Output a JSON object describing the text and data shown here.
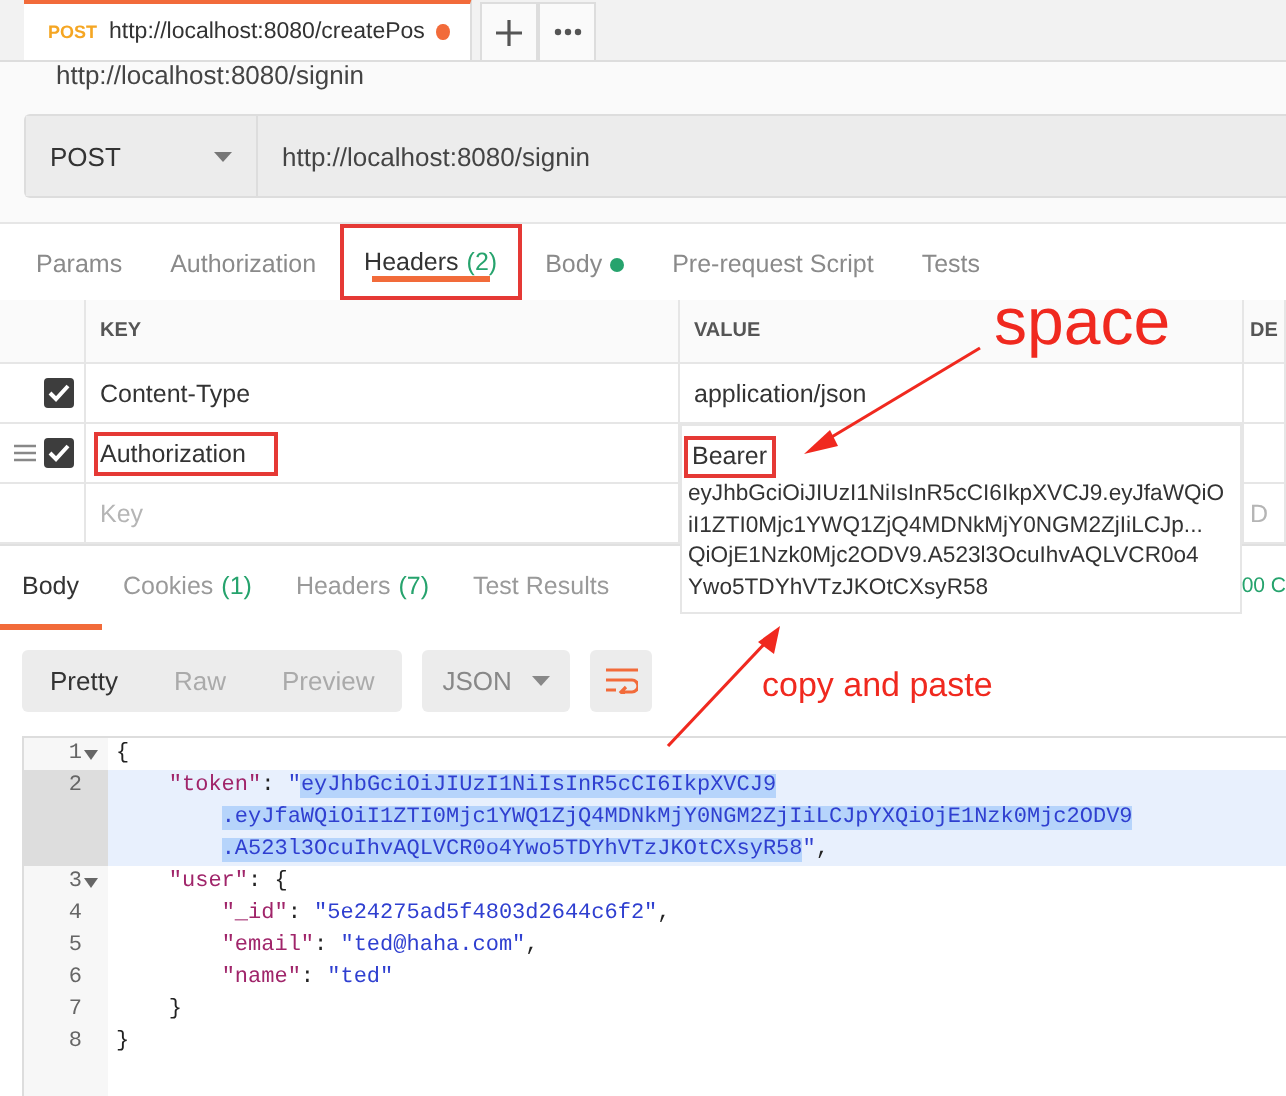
{
  "tabs": [
    {
      "method": "POST",
      "url": "http://localhost:8080/createPos",
      "unsaved": true,
      "selected": true
    }
  ],
  "request_name": "http://localhost:8080/signin",
  "request": {
    "method": "POST",
    "url": "http://localhost:8080/signin"
  },
  "request_tabs": [
    {
      "label": "Params",
      "selected": false,
      "highlighted": false,
      "has_content": false
    },
    {
      "label": "Authorization",
      "selected": false,
      "highlighted": false,
      "has_content": false
    },
    {
      "label": "Headers",
      "count": "(2)",
      "selected": true,
      "highlighted": true,
      "has_content": false
    },
    {
      "label": "Body",
      "selected": false,
      "highlighted": false,
      "has_content": true
    },
    {
      "label": "Pre-request Script",
      "selected": false,
      "highlighted": false,
      "has_content": false
    },
    {
      "label": "Tests",
      "selected": false,
      "highlighted": false,
      "has_content": false
    }
  ],
  "headers": {
    "columns": [
      "KEY",
      "VALUE",
      "DE"
    ],
    "rows": [
      {
        "key": "Content-Type",
        "value": "application/json",
        "checked": true,
        "key_highlighted": false,
        "value_highlighted": false,
        "drag_handle": false,
        "expanded": false
      },
      {
        "key": "Authorization",
        "value": "Bearer",
        "value_continuation": [
          "eyJhbGciOiJIUzI1NiIsInR5cCI6IkpXVCJ9.eyJfaWQiO",
          "iI1ZTI0Mjc1YWQ1ZjQ4MDNkMjY0NGM2ZjIiLCJp...",
          "QiOjE1Nzk0Mjc2ODV9.A523l3OcuIhvAQLVCR0o4",
          "Ywo5TDYhVTzJKOtCXsyR58"
        ],
        "checked": true,
        "key_highlighted": true,
        "value_highlighted": true,
        "drag_handle": true,
        "expanded": true
      }
    ],
    "new_row": {
      "key_placeholder": "Key",
      "description_placeholder": "D"
    }
  },
  "response_tabs": [
    {
      "label": "Body",
      "selected": true
    },
    {
      "label": "Cookies",
      "count": "(1)",
      "selected": false
    },
    {
      "label": "Headers",
      "count": "(7)",
      "selected": false
    },
    {
      "label": "Test Results",
      "selected": false
    }
  ],
  "status_fragment": "00 C",
  "view_modes": [
    {
      "label": "Pretty",
      "selected": true
    },
    {
      "label": "Raw",
      "selected": false
    },
    {
      "label": "Preview",
      "selected": false
    }
  ],
  "format": "JSON",
  "code": [
    {
      "number": "1",
      "foldable": true,
      "tokens": [
        {
          "kind": "punct",
          "text": "{"
        }
      ],
      "children": [
        {
          "number": "2",
          "foldable": false,
          "tokens": [
            {
              "kind": "key",
              "text": "\"token\""
            },
            {
              "kind": "punct",
              "text": ": "
            },
            {
              "kind": "string",
              "text": "\""
            },
            {
              "kind": "string",
              "selected": true,
              "parts": [
                "eyJhbGciOiJIUzI1NiIsInR5cCI6IkpXVCJ9",
                ".eyJfaWQiOiI1ZTI0Mjc1YWQ1ZjQ4MDNkMjY0NGM2ZjIiLCJpYXQiOjE1Nzk0Mjc2ODV9",
                ".A523l3OcuIhvAQLVCR0o4Ywo5TDYhVTzJKOtCXsyR58"
              ]
            },
            {
              "kind": "string",
              "text": "\""
            },
            {
              "kind": "punct",
              "text": ","
            }
          ]
        },
        {
          "number": "3",
          "foldable": true,
          "tokens": [
            {
              "kind": "key",
              "text": "\"user\""
            },
            {
              "kind": "punct",
              "text": ": {"
            }
          ],
          "children": [
            {
              "number": "4",
              "foldable": false,
              "tokens": [
                {
                  "kind": "key",
                  "text": "\"_id\""
                },
                {
                  "kind": "punct",
                  "text": ": "
                },
                {
                  "kind": "string",
                  "text": "\"5e24275ad5f4803d2644c6f2\""
                },
                {
                  "kind": "punct",
                  "text": ","
                }
              ]
            },
            {
              "number": "5",
              "foldable": false,
              "tokens": [
                {
                  "kind": "key",
                  "text": "\"email\""
                },
                {
                  "kind": "punct",
                  "text": ": "
                },
                {
                  "kind": "string",
                  "text": "\"ted@haha.com\""
                },
                {
                  "kind": "punct",
                  "text": ","
                }
              ]
            },
            {
              "number": "6",
              "foldable": false,
              "tokens": [
                {
                  "kind": "key",
                  "text": "\"name\""
                },
                {
                  "kind": "punct",
                  "text": ": "
                },
                {
                  "kind": "string",
                  "text": "\"ted\""
                }
              ]
            }
          ]
        },
        {
          "number": "7",
          "foldable": false,
          "tokens": [
            {
              "kind": "punct",
              "text": "}"
            }
          ]
        }
      ]
    },
    {
      "number": "8",
      "foldable": false,
      "tokens": [
        {
          "kind": "punct",
          "text": "}"
        }
      ]
    }
  ],
  "annotations": [
    {
      "text": "space"
    },
    {
      "text": "copy and paste"
    }
  ]
}
